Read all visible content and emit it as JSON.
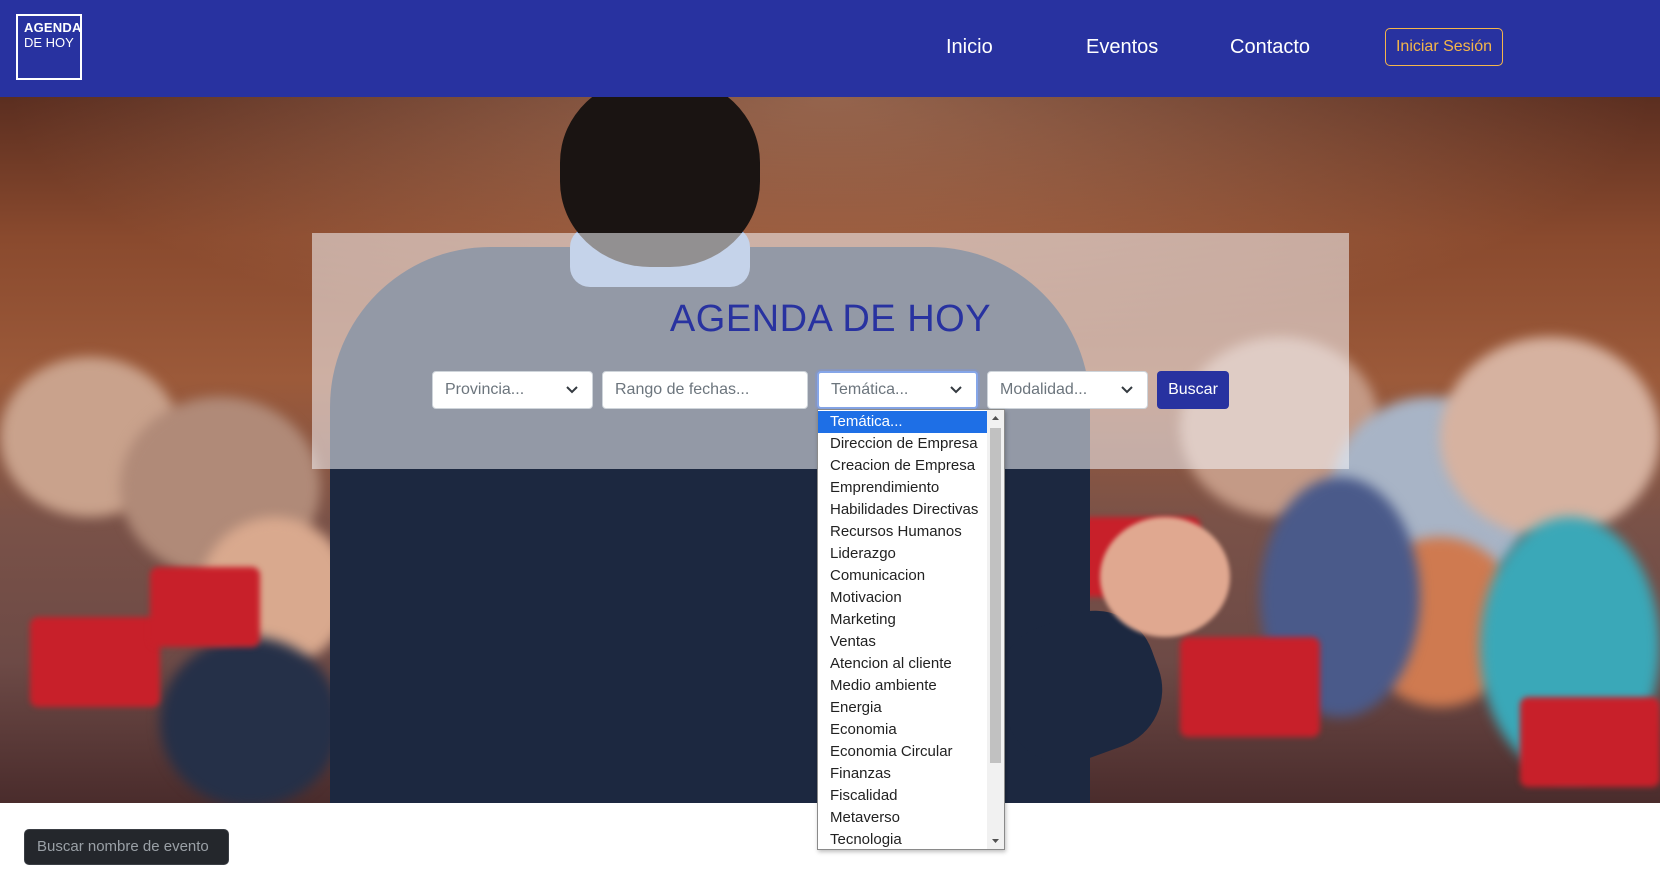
{
  "brand": {
    "logo_line1": "AGENDA",
    "logo_line2": "DE HOY"
  },
  "nav": {
    "inicio": "Inicio",
    "eventos": "Eventos",
    "contacto": "Contacto",
    "login": "Iniciar Sesión"
  },
  "hero": {
    "title": "AGENDA DE HOY"
  },
  "filters": {
    "provincia": "Provincia...",
    "fechas": "Rango de fechas...",
    "tematica": "Temática...",
    "modalidad": "Modalidad...",
    "buscar": "Buscar"
  },
  "tematica_options": [
    "Temática...",
    "Direccion de Empresa",
    "Creacion de Empresa",
    "Emprendimiento",
    "Habilidades Directivas",
    "Recursos Humanos",
    "Liderazgo",
    "Comunicacion",
    "Motivacion",
    "Marketing",
    "Ventas",
    "Atencion al cliente",
    "Medio ambiente",
    "Energia",
    "Economia",
    "Economia Circular",
    "Finanzas",
    "Fiscalidad",
    "Metaverso",
    "Tecnologia"
  ],
  "search_event": {
    "placeholder": "Buscar nombre de evento"
  },
  "colors": {
    "brand": "#2832a0",
    "accent": "#f5b64a",
    "selected": "#1e6fe6"
  }
}
